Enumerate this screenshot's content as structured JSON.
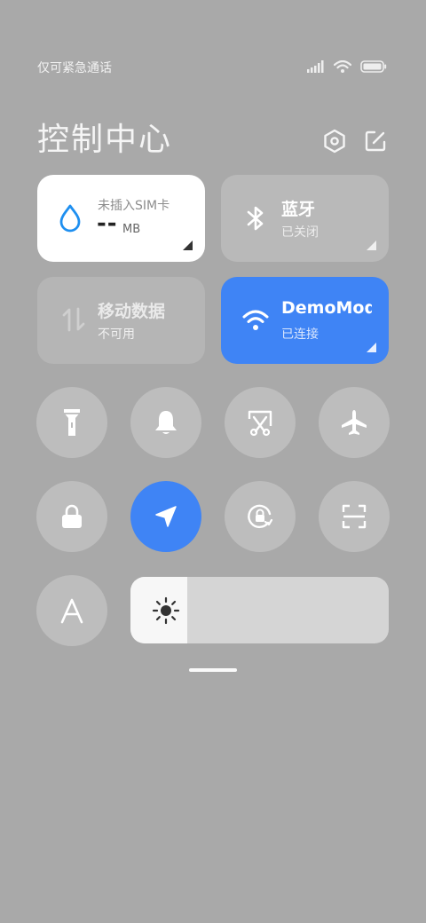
{
  "status_bar": {
    "carrier_text": "仅可紧急通话",
    "icons": [
      "signal-icon",
      "wifi-icon",
      "battery-icon"
    ]
  },
  "header": {
    "title": "控制中心",
    "settings_icon": "hexagon-settings-icon",
    "edit_icon": "edit-icon"
  },
  "tiles": {
    "data_usage": {
      "label": "未插入SIM卡",
      "value": "--",
      "unit": "MB",
      "icon": "water-drop-icon"
    },
    "bluetooth": {
      "title": "蓝牙",
      "status": "已关闭",
      "icon": "bluetooth-icon"
    },
    "mobile_data": {
      "title": "移动数据",
      "status": "不可用",
      "icon": "data-transfer-icon"
    },
    "wifi": {
      "title": "DemoMod",
      "status": "已连接",
      "icon": "wifi-icon"
    }
  },
  "toggles": [
    {
      "name": "flashlight",
      "icon": "flashlight-icon",
      "active": false
    },
    {
      "name": "mute",
      "icon": "bell-icon",
      "active": false
    },
    {
      "name": "screenshot",
      "icon": "scissors-screenshot-icon",
      "active": false
    },
    {
      "name": "airplane-mode",
      "icon": "airplane-icon",
      "active": false
    },
    {
      "name": "lock-screen",
      "icon": "lock-icon",
      "active": false
    },
    {
      "name": "location",
      "icon": "location-arrow-icon",
      "active": true
    },
    {
      "name": "auto-rotate",
      "icon": "rotation-lock-icon",
      "active": false
    },
    {
      "name": "scanner",
      "icon": "scan-icon",
      "active": false
    },
    {
      "name": "font-size",
      "icon": "font-a-icon",
      "active": false
    }
  ],
  "brightness": {
    "level_percent": 22,
    "icon": "sun-icon"
  },
  "colors": {
    "background": "#a9a9a9",
    "accent_blue": "#3f84f5",
    "tile_white": "#ffffff",
    "tile_gray": "#b9b9b9",
    "round_gray": "#bdbdbd"
  }
}
